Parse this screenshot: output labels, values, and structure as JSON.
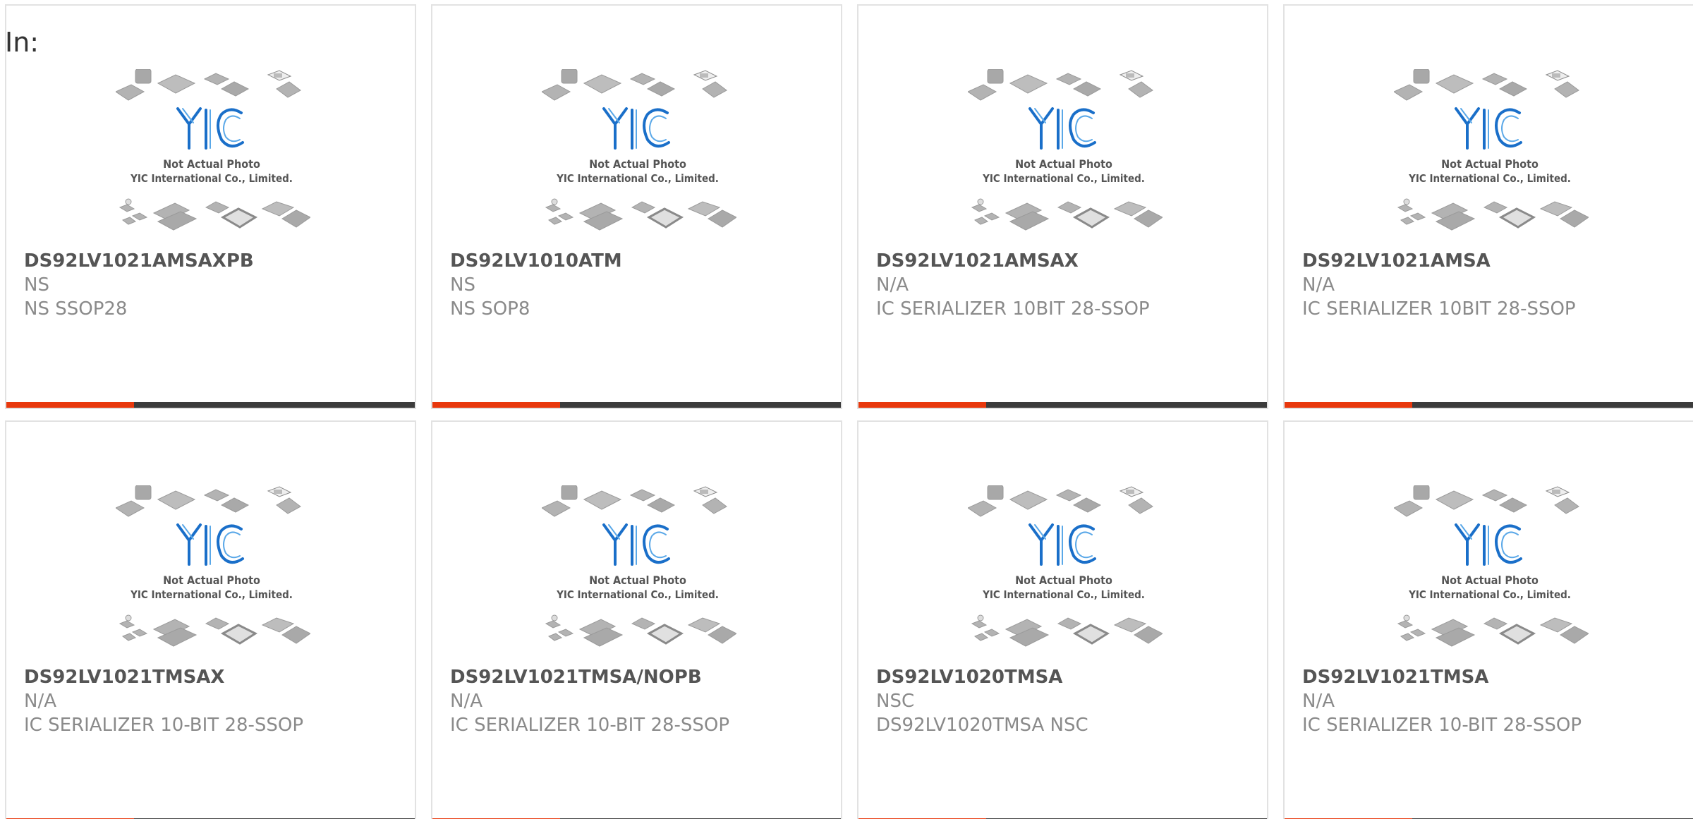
{
  "header": {
    "label": "In:"
  },
  "colors": {
    "accent": "#e8380d",
    "bar": "#3c3c3c",
    "logo_blue": "#1a6fc9",
    "chip_gray": "#b3b3b3"
  },
  "placeholder_photo": {
    "line1": "Not Actual Photo",
    "line2": "YIC International Co., Limited."
  },
  "products": [
    {
      "name": "DS92LV1021AMSAXPB",
      "manufacturer": "NS",
      "description": "NS SSOP28"
    },
    {
      "name": "DS92LV1010ATM",
      "manufacturer": "NS",
      "description": "NS SOP8"
    },
    {
      "name": "DS92LV1021AMSAX",
      "manufacturer": "N/A",
      "description": "IC SERIALIZER 10BIT 28-SSOP"
    },
    {
      "name": "DS92LV1021AMSA",
      "manufacturer": "N/A",
      "description": "IC SERIALIZER 10BIT 28-SSOP"
    },
    {
      "name": "DS92LV1021TMSAX",
      "manufacturer": "N/A",
      "description": "IC SERIALIZER 10-BIT 28-SSOP"
    },
    {
      "name": "DS92LV1021TMSA/NOPB",
      "manufacturer": "N/A",
      "description": "IC SERIALIZER 10-BIT 28-SSOP"
    },
    {
      "name": "DS92LV1020TMSA",
      "manufacturer": "NSC",
      "description": "DS92LV1020TMSA NSC"
    },
    {
      "name": "DS92LV1021TMSA",
      "manufacturer": "N/A",
      "description": "IC SERIALIZER 10-BIT 28-SSOP"
    }
  ]
}
